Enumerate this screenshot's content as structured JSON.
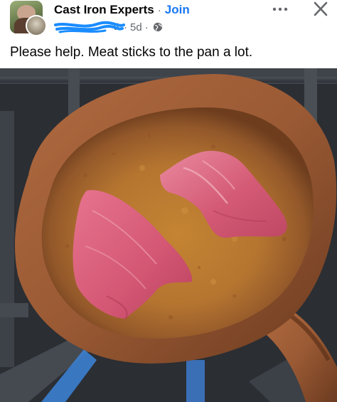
{
  "post": {
    "group_name": "Cast Iron Experts",
    "separator": "·",
    "join_label": "Join",
    "author_visible_fragment": "tt",
    "time_ago": "5d",
    "privacy_icon": "globe-icon",
    "more_icon": "more-horizontal-icon",
    "close_icon": "close-icon",
    "text": "Please help. Meat sticks to the pan a lot."
  },
  "colors": {
    "link": "#1877f2",
    "secondary_text": "#65676b",
    "primary_text": "#050505",
    "redaction": "#1a8cff"
  }
}
